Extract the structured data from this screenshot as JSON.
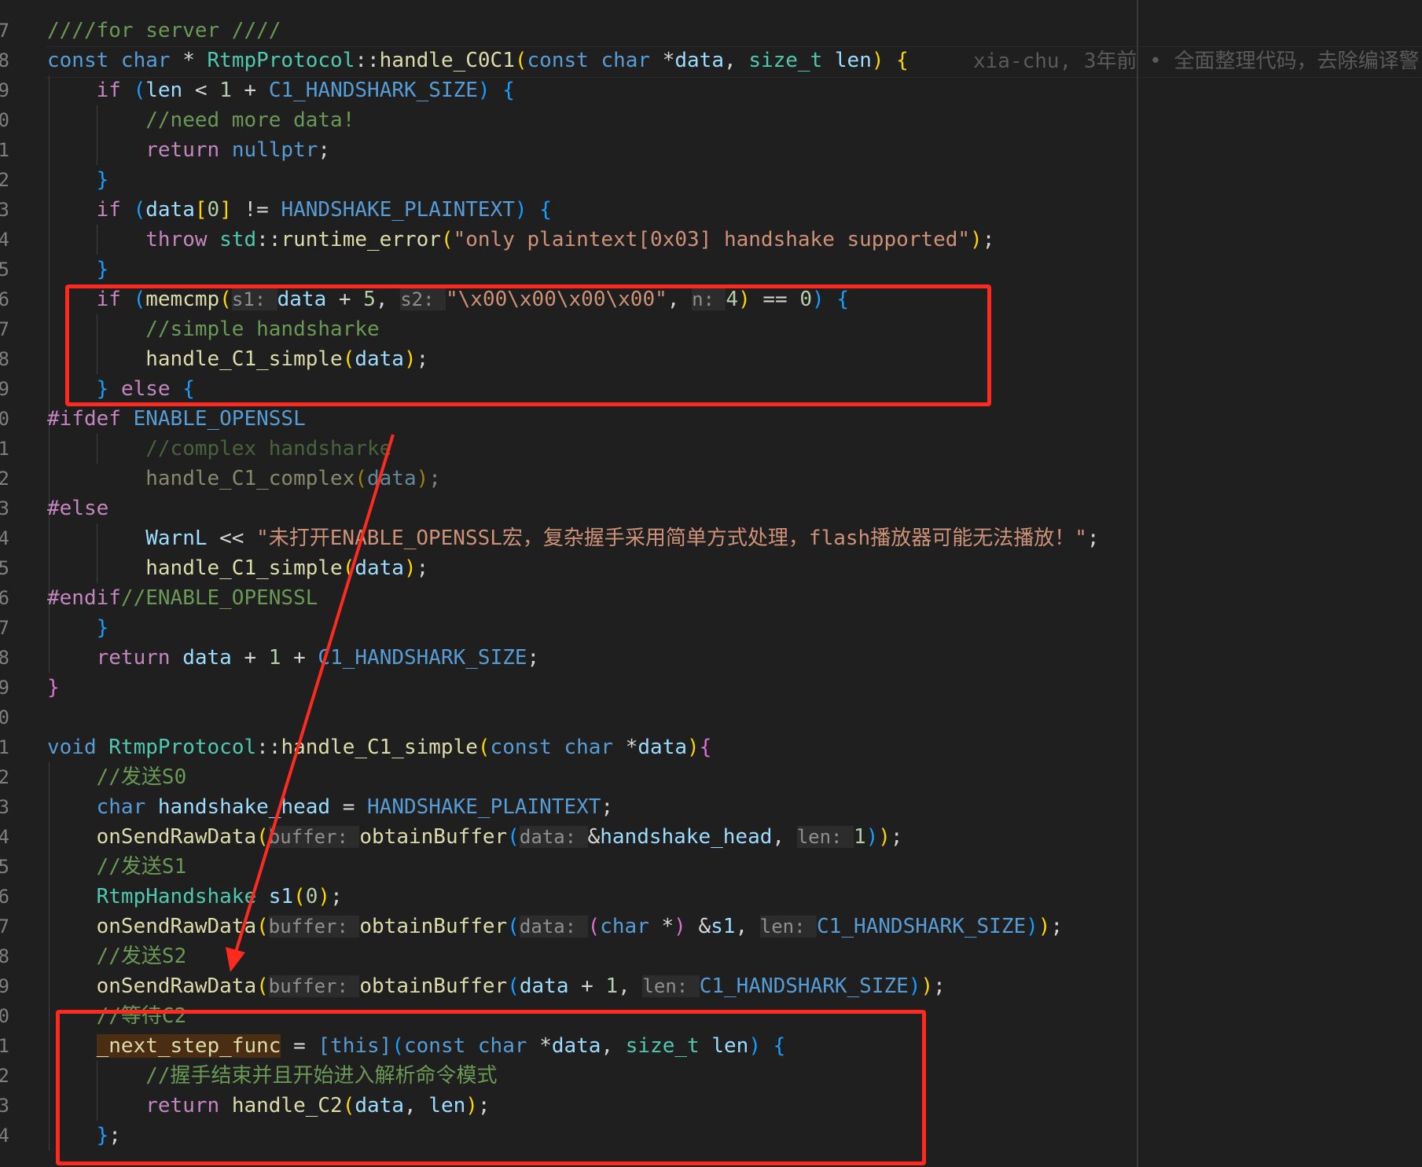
{
  "colors": {
    "keyword": "#569cd6",
    "control": "#c586c0",
    "func": "#dcdcaa",
    "type": "#4ec9b0",
    "var": "#9cdcfe",
    "string": "#ce9178",
    "comment": "#6a9955",
    "number": "#b5cea8",
    "macro": "#569cd6",
    "hint": "#8f8f8f",
    "annotation": "#ff2a1f"
  },
  "gutter": [
    "7",
    "8",
    "9",
    "0",
    "1",
    "2",
    "3",
    "4",
    "5",
    "6",
    "7",
    "8",
    "9",
    "0",
    "1",
    "2",
    "3",
    "4",
    "5",
    "6",
    "7",
    "8",
    "9",
    "0",
    "1",
    "2",
    "3",
    "4",
    "5",
    "6",
    "7",
    "8",
    "9",
    "0",
    "1",
    "2",
    "3",
    "4"
  ],
  "blame": "xia-chu, 3年前 • 全面整理代码，去除编译警",
  "lines": [
    [
      [
        "comment",
        "////for server ////"
      ]
    ],
    [
      [
        "keyword",
        "const "
      ],
      [
        "keyword",
        "char "
      ],
      [
        "plain",
        "* "
      ],
      [
        "type",
        "RtmpProtocol"
      ],
      [
        "plain",
        "::"
      ],
      [
        "func",
        "handle_C0C1"
      ],
      [
        "paren1",
        "("
      ],
      [
        "keyword",
        "const "
      ],
      [
        "keyword",
        "char "
      ],
      [
        "plain",
        "*"
      ],
      [
        "var",
        "data"
      ],
      [
        "plain",
        ", "
      ],
      [
        "type",
        "size_t "
      ],
      [
        "var",
        "len"
      ],
      [
        "paren1",
        ") {"
      ]
    ],
    [
      [
        "plain",
        "    "
      ],
      [
        "control",
        "if "
      ],
      [
        "paren2",
        "("
      ],
      [
        "var",
        "len "
      ],
      [
        "plain",
        "< "
      ],
      [
        "number",
        "1 "
      ],
      [
        "plain",
        "+ "
      ],
      [
        "macro",
        "C1_HANDSHARK_SIZE"
      ],
      [
        "paren2",
        ") {"
      ]
    ],
    [
      [
        "plain",
        "        "
      ],
      [
        "comment",
        "//need more data!"
      ]
    ],
    [
      [
        "plain",
        "        "
      ],
      [
        "control",
        "return "
      ],
      [
        "keyword",
        "nullptr"
      ],
      [
        "plain",
        ";"
      ]
    ],
    [
      [
        "plain",
        "    "
      ],
      [
        "paren2",
        "}"
      ]
    ],
    [
      [
        "plain",
        "    "
      ],
      [
        "control",
        "if "
      ],
      [
        "paren2",
        "("
      ],
      [
        "var",
        "data"
      ],
      [
        "paren1",
        "["
      ],
      [
        "number",
        "0"
      ],
      [
        "paren1",
        "]"
      ],
      [
        "plain",
        " != "
      ],
      [
        "macro",
        "HANDSHAKE_PLAINTEXT"
      ],
      [
        "paren2",
        ") {"
      ]
    ],
    [
      [
        "plain",
        "        "
      ],
      [
        "control",
        "throw "
      ],
      [
        "type",
        "std"
      ],
      [
        "plain",
        "::"
      ],
      [
        "func",
        "runtime_error"
      ],
      [
        "paren1",
        "("
      ],
      [
        "string",
        "\"only plaintext[0x03] handshake supported\""
      ],
      [
        "paren1",
        ")"
      ],
      [
        "plain",
        ";"
      ]
    ],
    [
      [
        "plain",
        "    "
      ],
      [
        "paren2",
        "}"
      ]
    ],
    [
      [
        "plain",
        "    "
      ],
      [
        "control",
        "if "
      ],
      [
        "paren2",
        "("
      ],
      [
        "func",
        "memcmp"
      ],
      [
        "paren1",
        "("
      ],
      [
        "hint",
        "s1: "
      ],
      [
        "var",
        "data "
      ],
      [
        "plain",
        "+ "
      ],
      [
        "number",
        "5"
      ],
      [
        "plain",
        ", "
      ],
      [
        "hint",
        "s2: "
      ],
      [
        "string",
        "\"\\x00\\x00\\x00\\x00\""
      ],
      [
        "plain",
        ", "
      ],
      [
        "hint",
        "n: "
      ],
      [
        "number",
        "4"
      ],
      [
        "paren1",
        ")"
      ],
      [
        "plain",
        " == "
      ],
      [
        "number",
        "0"
      ],
      [
        "paren2",
        ") {"
      ]
    ],
    [
      [
        "plain",
        "        "
      ],
      [
        "comment",
        "//simple handsharke"
      ]
    ],
    [
      [
        "plain",
        "        "
      ],
      [
        "func",
        "handle_C1_simple"
      ],
      [
        "paren1",
        "("
      ],
      [
        "var",
        "data"
      ],
      [
        "paren1",
        ")"
      ],
      [
        "plain",
        ";"
      ]
    ],
    [
      [
        "plain",
        "    "
      ],
      [
        "paren2",
        "} "
      ],
      [
        "control",
        "else "
      ],
      [
        "paren2",
        "{"
      ]
    ],
    [
      [
        "control",
        "#ifdef "
      ],
      [
        "macro",
        "ENABLE_OPENSSL"
      ]
    ],
    [
      [
        "plain",
        "        "
      ],
      [
        "dimcomment",
        "//complex handsharke"
      ]
    ],
    [
      [
        "plain",
        "        "
      ],
      [
        "dimfunc",
        "handle_C1_complex"
      ],
      [
        "dimparen",
        "("
      ],
      [
        "dimvar",
        "data"
      ],
      [
        "dimparen",
        ")"
      ],
      [
        "dimplain",
        ";"
      ]
    ],
    [
      [
        "control",
        "#else"
      ]
    ],
    [
      [
        "plain",
        "        "
      ],
      [
        "var",
        "WarnL "
      ],
      [
        "plain",
        "<< "
      ],
      [
        "string",
        "\"未打开ENABLE_OPENSSL宏，复杂握手采用简单方式处理，flash播放器可能无法播放！\""
      ],
      [
        "plain",
        ";"
      ]
    ],
    [
      [
        "plain",
        "        "
      ],
      [
        "func",
        "handle_C1_simple"
      ],
      [
        "paren1",
        "("
      ],
      [
        "var",
        "data"
      ],
      [
        "paren1",
        ")"
      ],
      [
        "plain",
        ";"
      ]
    ],
    [
      [
        "control",
        "#endif"
      ],
      [
        "comment",
        "//ENABLE_OPENSSL"
      ]
    ],
    [
      [
        "plain",
        "    "
      ],
      [
        "paren2",
        "}"
      ]
    ],
    [
      [
        "plain",
        "    "
      ],
      [
        "control",
        "return "
      ],
      [
        "var",
        "data "
      ],
      [
        "plain",
        "+ "
      ],
      [
        "number",
        "1 "
      ],
      [
        "plain",
        "+ "
      ],
      [
        "macro",
        "C1_HANDSHARK_SIZE"
      ],
      [
        "plain",
        ";"
      ]
    ],
    [
      [
        "paren3",
        "}"
      ]
    ],
    [],
    [
      [
        "keyword",
        "void "
      ],
      [
        "type",
        "RtmpProtocol"
      ],
      [
        "plain",
        "::"
      ],
      [
        "func",
        "handle_C1_simple"
      ],
      [
        "paren1",
        "("
      ],
      [
        "keyword",
        "const "
      ],
      [
        "keyword",
        "char "
      ],
      [
        "plain",
        "*"
      ],
      [
        "var",
        "data"
      ],
      [
        "paren1",
        ")"
      ],
      [
        "paren3",
        "{"
      ]
    ],
    [
      [
        "plain",
        "    "
      ],
      [
        "comment",
        "//发送S0"
      ]
    ],
    [
      [
        "plain",
        "    "
      ],
      [
        "keyword",
        "char "
      ],
      [
        "var",
        "handshake_head "
      ],
      [
        "plain",
        "= "
      ],
      [
        "macro",
        "HANDSHAKE_PLAINTEXT"
      ],
      [
        "plain",
        ";"
      ]
    ],
    [
      [
        "plain",
        "    "
      ],
      [
        "func",
        "onSendRawData"
      ],
      [
        "paren1",
        "("
      ],
      [
        "hint",
        "buffer: "
      ],
      [
        "func",
        "obtainBuffer"
      ],
      [
        "paren2",
        "("
      ],
      [
        "hint",
        "data: "
      ],
      [
        "plain",
        "&"
      ],
      [
        "var",
        "handshake_head"
      ],
      [
        "plain",
        ", "
      ],
      [
        "hint",
        "len: "
      ],
      [
        "number",
        "1"
      ],
      [
        "paren2",
        ")"
      ],
      [
        "paren1",
        ")"
      ],
      [
        "plain",
        ";"
      ]
    ],
    [
      [
        "plain",
        "    "
      ],
      [
        "comment",
        "//发送S1"
      ]
    ],
    [
      [
        "plain",
        "    "
      ],
      [
        "type",
        "RtmpHandshake "
      ],
      [
        "var",
        "s1"
      ],
      [
        "paren1",
        "("
      ],
      [
        "number",
        "0"
      ],
      [
        "paren1",
        ")"
      ],
      [
        "plain",
        ";"
      ]
    ],
    [
      [
        "plain",
        "    "
      ],
      [
        "func",
        "onSendRawData"
      ],
      [
        "paren1",
        "("
      ],
      [
        "hint",
        "buffer: "
      ],
      [
        "func",
        "obtainBuffer"
      ],
      [
        "paren2",
        "("
      ],
      [
        "hint",
        "data: "
      ],
      [
        "paren3",
        "("
      ],
      [
        "keyword",
        "char "
      ],
      [
        "plain",
        "*"
      ],
      [
        "paren3",
        ") "
      ],
      [
        "plain",
        "&"
      ],
      [
        "var",
        "s1"
      ],
      [
        "plain",
        ", "
      ],
      [
        "hint",
        "len: "
      ],
      [
        "macro",
        "C1_HANDSHARK_SIZE"
      ],
      [
        "paren2",
        ")"
      ],
      [
        "paren1",
        ")"
      ],
      [
        "plain",
        ";"
      ]
    ],
    [
      [
        "plain",
        "    "
      ],
      [
        "comment",
        "//发送S2"
      ]
    ],
    [
      [
        "plain",
        "    "
      ],
      [
        "func",
        "onSendRawData"
      ],
      [
        "paren1",
        "("
      ],
      [
        "hint",
        "buffer: "
      ],
      [
        "func",
        "obtainBuffer"
      ],
      [
        "paren2",
        "("
      ],
      [
        "var",
        "data "
      ],
      [
        "plain",
        "+ "
      ],
      [
        "number",
        "1"
      ],
      [
        "plain",
        ", "
      ],
      [
        "hint",
        "len: "
      ],
      [
        "macro",
        "C1_HANDSHARK_SIZE"
      ],
      [
        "paren2",
        ")"
      ],
      [
        "paren1",
        ")"
      ],
      [
        "plain",
        ";"
      ]
    ],
    [
      [
        "plain",
        "    "
      ],
      [
        "comment",
        "//等待C2"
      ]
    ],
    [
      [
        "plain",
        "    "
      ],
      [
        "hlvar",
        "_next_step_func"
      ],
      [
        "plain",
        " = "
      ],
      [
        "keyword",
        "[this]"
      ],
      [
        "paren2",
        "("
      ],
      [
        "keyword",
        "const "
      ],
      [
        "keyword",
        "char "
      ],
      [
        "plain",
        "*"
      ],
      [
        "var",
        "data"
      ],
      [
        "plain",
        ", "
      ],
      [
        "type",
        "size_t "
      ],
      [
        "var",
        "len"
      ],
      [
        "paren2",
        ") {"
      ]
    ],
    [
      [
        "plain",
        "        "
      ],
      [
        "comment",
        "//握手结束并且开始进入解析命令模式"
      ]
    ],
    [
      [
        "plain",
        "        "
      ],
      [
        "control",
        "return "
      ],
      [
        "func",
        "handle_C2"
      ],
      [
        "paren1",
        "("
      ],
      [
        "var",
        "data"
      ],
      [
        "plain",
        ", "
      ],
      [
        "var",
        "len"
      ],
      [
        "paren1",
        ")"
      ],
      [
        "plain",
        ";"
      ]
    ],
    [
      [
        "plain",
        "    "
      ],
      [
        "paren2",
        "}"
      ],
      [
        "plain",
        ";"
      ]
    ]
  ]
}
